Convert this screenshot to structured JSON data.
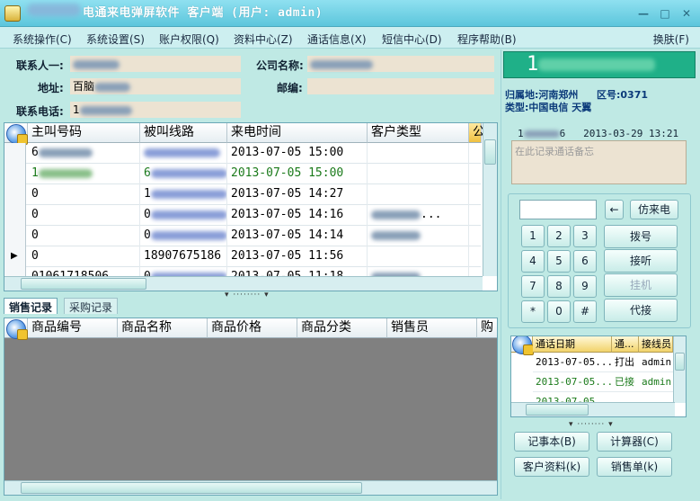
{
  "window": {
    "title": "电通来电弹屏软件 客户端 (用户: admin)",
    "minimize": "—",
    "maximize": "□",
    "close": "✕"
  },
  "menu": [
    {
      "label": "系统操作(C)"
    },
    {
      "label": "系统设置(S)"
    },
    {
      "label": "账户权限(Q)"
    },
    {
      "label": "资料中心(Z)"
    },
    {
      "label": "通话信息(X)"
    },
    {
      "label": "短信中心(D)"
    },
    {
      "label": "程序帮助(B)"
    }
  ],
  "skin_label": "换肤(F)",
  "contact": {
    "person_label": "联系人一:",
    "company_label": "公司名称:",
    "address_label": "地址:",
    "address_value": "百脑",
    "postcode_label": "邮编:",
    "phone_label": "联系电话:",
    "phone_value": "1"
  },
  "calls_table": {
    "headers": [
      "主叫号码",
      "被叫线路",
      "来电时间",
      "客户类型",
      "公"
    ],
    "rows": [
      {
        "caller": "6",
        "line": "",
        "time": "2013-07-05 15:00",
        "type": "",
        "color": "#000000"
      },
      {
        "caller": "1",
        "line": "6",
        "time": "2013-07-05 15:00",
        "type": "",
        "color": "#1a7a1a"
      },
      {
        "caller": "0",
        "line": "1",
        "time": "2013-07-05 14:27",
        "type": "",
        "color": "#000000"
      },
      {
        "caller": "0",
        "line": "0",
        "time": "2013-07-05 14:16",
        "type": "...",
        "color": "#000000"
      },
      {
        "caller": "0",
        "line": "0",
        "time": "2013-07-05 14:14",
        "type": "",
        "color": "#000000"
      },
      {
        "caller": "0",
        "line": "18907675186",
        "time": "2013-07-05 11:56",
        "type": "",
        "color": "#000000"
      },
      {
        "caller": "01061718506",
        "line": "0",
        "time": "2013-07-05 11:18",
        "type": "",
        "color": "#000000"
      }
    ],
    "current_row_marker": "▶"
  },
  "bottom_tabs": [
    {
      "label": "销售记录"
    },
    {
      "label": "采购记录"
    }
  ],
  "sales_table": {
    "headers": [
      "商品编号",
      "商品名称",
      "商品价格",
      "商品分类",
      "销售员",
      "购"
    ]
  },
  "caller_panel": {
    "number_prefix": "1",
    "location_label": "归属地:",
    "location_value": "河南郑州",
    "area_label": "区号:",
    "area_value": "0371",
    "type_label": "类型:",
    "type_value": "中国电信 天翼",
    "note_number": "1",
    "note_number_tail": "6",
    "note_time": "2013-03-29 13:21",
    "note_placeholder": "在此记录通话备忘"
  },
  "dialpad": {
    "back": "←",
    "simulate": "仿来电",
    "keys": [
      "1",
      "2",
      "3",
      "4",
      "5",
      "6",
      "7",
      "8",
      "9",
      "*",
      "0",
      "#"
    ],
    "dial": "拨号",
    "answer": "接听",
    "hangup": "挂机",
    "hold": "代接"
  },
  "history_table": {
    "headers": [
      "通话日期",
      "通...",
      "接线员"
    ],
    "rows": [
      {
        "date": "2013-07-05...",
        "kind": "打出",
        "op": "admin",
        "color": "#000000"
      },
      {
        "date": "2013-07-05...",
        "kind": "已接",
        "op": "admin",
        "color": "#1a7a1a"
      },
      {
        "date": "2013-07-05...",
        "kind": "",
        "op": "",
        "color": "#1a7a1a"
      }
    ]
  },
  "tools": {
    "notepad": "记事本(B)",
    "calculator": "计算器(C)",
    "customer": "客户资料(k)",
    "sales_order": "销售单(k)"
  },
  "colors": {
    "window_bg": "#bfe9e4",
    "title_bar": "#5cc6dc",
    "phone_display": "#1fb088",
    "grid2_bg": "#808080"
  }
}
